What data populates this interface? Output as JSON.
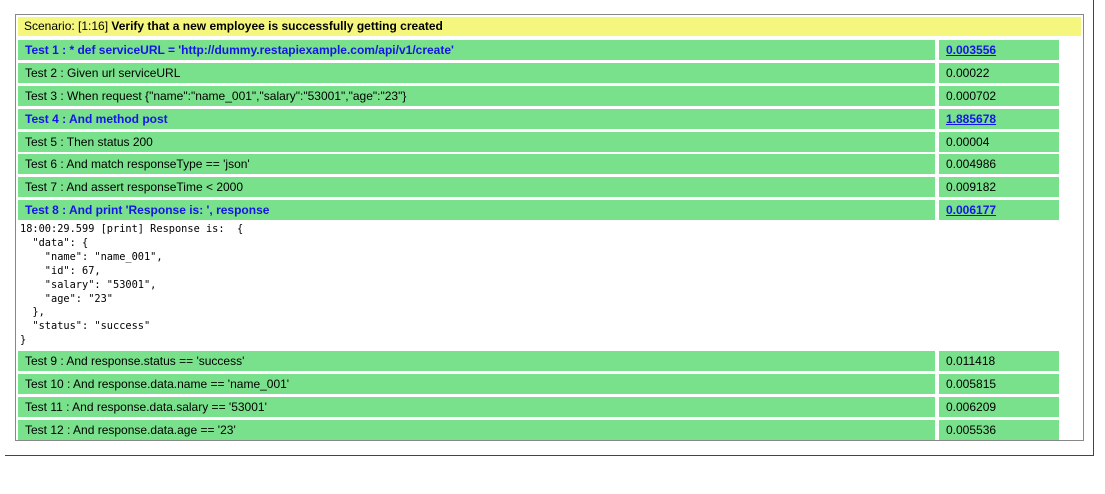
{
  "scenario": {
    "prefix": "Scenario: [1:16]",
    "title": "Verify that a new employee is successfully getting created"
  },
  "steps": [
    {
      "label": "Test 1 : * def serviceURL = 'http://dummy.restapiexample.com/api/v1/create'",
      "time": "0.003556",
      "highlight": true
    },
    {
      "label": "Test 2 : Given url serviceURL",
      "time": "0.00022",
      "highlight": false
    },
    {
      "label": "Test 3 : When request {\"name\":\"name_001\",\"salary\":\"53001\",\"age\":\"23\"}",
      "time": "0.000702",
      "highlight": false
    },
    {
      "label": "Test 4 : And method post",
      "time": "1.885678",
      "highlight": true
    },
    {
      "label": "Test 5 : Then status 200",
      "time": "0.00004",
      "highlight": false
    },
    {
      "label": "Test 6 : And match responseType == 'json'",
      "time": "0.004986",
      "highlight": false
    },
    {
      "label": "Test 7 : And assert responseTime < 2000",
      "time": "0.009182",
      "highlight": false
    },
    {
      "label": "Test 8 : And print 'Response is: ', response",
      "time": "0.006177",
      "highlight": true
    },
    {
      "label": "Test 9 : And response.status == 'success'",
      "time": "0.011418",
      "highlight": false
    },
    {
      "label": "Test 10 : And response.data.name == 'name_001'",
      "time": "0.005815",
      "highlight": false
    },
    {
      "label": "Test 11 : And response.data.salary == '53001'",
      "time": "0.006209",
      "highlight": false
    },
    {
      "label": "Test 12 : And response.data.age == '23'",
      "time": "0.005536",
      "highlight": false
    }
  ],
  "log": "18:00:29.599 [print] Response is:  {\n  \"data\": {\n    \"name\": \"name_001\",\n    \"id\": 67,\n    \"salary\": \"53001\",\n    \"age\": \"23\"\n  },\n  \"status\": \"success\"\n}"
}
